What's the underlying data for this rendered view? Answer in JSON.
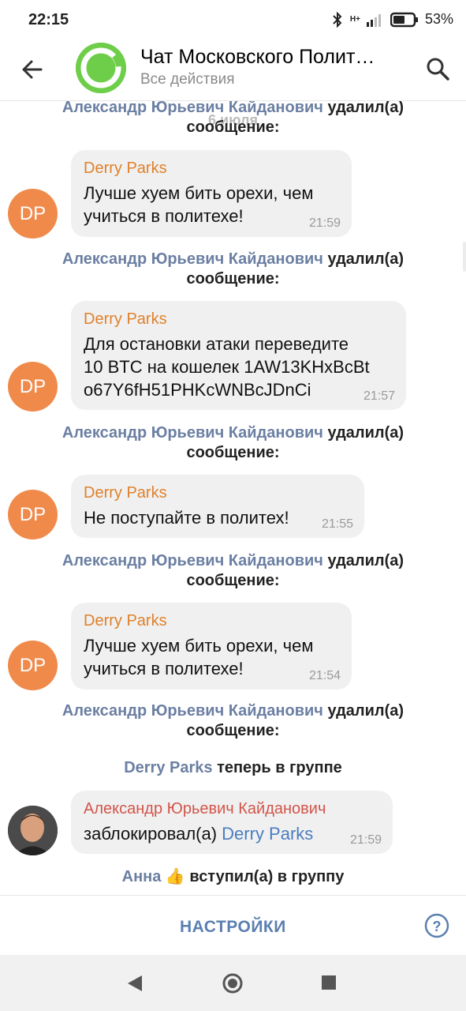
{
  "status_bar": {
    "time": "22:15",
    "network": "H+",
    "battery_pct": "53%"
  },
  "header": {
    "title": "Чат Московского Полит…",
    "subtitle": "Все действия",
    "accent": "#6fce49"
  },
  "messages": {
    "date_ghost": "6 июля",
    "service_1": {
      "actor": "Александр Юрьевич Кайданович",
      "text_a": "удалил(а)",
      "text_b": "сообщение:"
    },
    "msg_1": {
      "avatar": "DP",
      "sender": "Derry Parks",
      "line1": "Лучше хуем бить орехи, чем",
      "line2": "учиться в политехе!",
      "time": "21:59"
    },
    "service_2": {
      "actor": "Александр Юрьевич Кайданович",
      "text_a": "удалил(а)",
      "text_b": "сообщение:"
    },
    "msg_2": {
      "avatar": "DP",
      "sender": "Derry Parks",
      "line1": "Для остановки атаки переведите",
      "line2": "10 BTC на кошелек 1AW13KHxBcBt",
      "line3": "o67Y6fH51PHKcWNBcJDnCi",
      "time": "21:57"
    },
    "service_3": {
      "actor": "Александр Юрьевич Кайданович",
      "text_a": "удалил(а)",
      "text_b": "сообщение:"
    },
    "msg_3": {
      "avatar": "DP",
      "sender": "Derry Parks",
      "line1": "Не поступайте в политех!",
      "time": "21:55"
    },
    "service_4": {
      "actor": "Александр Юрьевич Кайданович",
      "text_a": "удалил(а)",
      "text_b": "сообщение:"
    },
    "msg_4": {
      "avatar": "DP",
      "sender": "Derry Parks",
      "line1": "Лучше хуем бить орехи, чем",
      "line2": "учиться в политехе!",
      "time": "21:54"
    },
    "service_5": {
      "actor": "Александр Юрьевич Кайданович",
      "text_a": "удалил(а)",
      "text_b": "сообщение:"
    },
    "service_6": {
      "actor": "Derry Parks",
      "text": "теперь в группе"
    },
    "msg_5": {
      "sender": "Александр Юрьевич Кайданович",
      "text": "заблокировал(а)",
      "target": "Derry Parks",
      "time": "21:59"
    },
    "service_7": {
      "actor": "Анна",
      "emoji": "👍",
      "text": "вступил(а) в группу"
    }
  },
  "bottom_bar": {
    "settings_label": "НАСТРОЙКИ",
    "help_label": "?"
  }
}
